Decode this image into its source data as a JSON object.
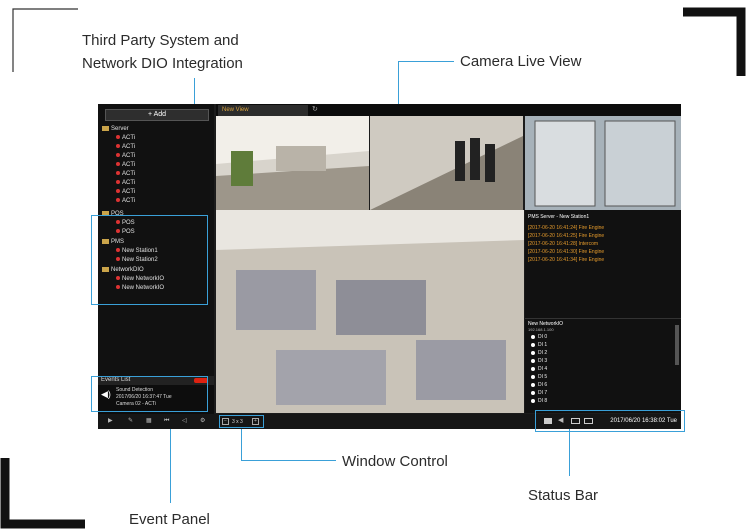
{
  "callouts": {
    "third_party_line1": "Third Party System and",
    "third_party_line2": "Network DIO Integration",
    "camera_live_view": "Camera Live View",
    "window_control": "Window Control",
    "status_bar": "Status Bar",
    "event_panel": "Event Panel"
  },
  "app": {
    "add_label": "+ Add",
    "tab_label": "New View",
    "tree": {
      "server": "Server",
      "server_items": [
        "ACTi",
        "ACTi",
        "ACTi",
        "ACTi",
        "ACTi",
        "ACTi",
        "ACTi",
        "ACTi"
      ],
      "pos": "POS",
      "pos_items": [
        "POS",
        "POS"
      ],
      "pms": "PMS",
      "pms_items": [
        "New Station1",
        "New Station2"
      ],
      "networkdio": "NetworkDIO",
      "networkdio_items": [
        "New NetworkIO",
        "New NetworkIO"
      ]
    },
    "events": {
      "title": "Events List",
      "line1": "Sound Detection",
      "line2": "2017/06/20 16:37:47 Tue",
      "line3": "Camera 02 - ACTi"
    },
    "window_control": {
      "layout": "3 x 3"
    },
    "side_panel": {
      "pms_title": "PMS Server - New Station1",
      "events": [
        "[2017-06-20 16:41:24] Fire Engine",
        "[2017-06-20 16:41:25] Fire Engine",
        "[2017-06-20 16:41:28] Intercom",
        "[2017-06-20 16:41:30] Fire Engine",
        "[2017-06-20 16:41:34] Fire Engine"
      ],
      "dio_title": "New NetworkIO",
      "dio_ip": "192.168.1.100",
      "dio_items": [
        "DI 0",
        "DI 1",
        "DI 2",
        "DI 3",
        "DI 4",
        "DI 5",
        "DI 6",
        "DI 7",
        "DI 8"
      ]
    },
    "status": {
      "datetime": "2017/06/20 16:38:02 Tue"
    }
  },
  "colors": {
    "accent": "#3aa0d8",
    "event_orange": "#e49a2c",
    "alarm_red": "#d21"
  }
}
